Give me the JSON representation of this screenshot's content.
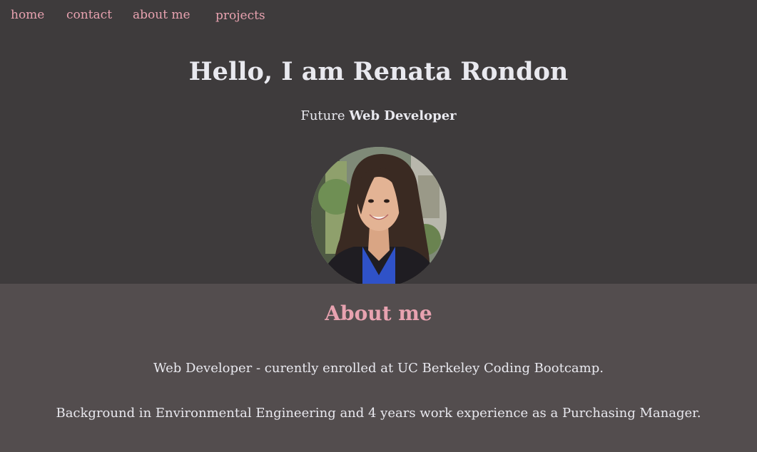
{
  "nav": {
    "items": [
      {
        "label": "home"
      },
      {
        "label": "contact"
      },
      {
        "label": "about me"
      },
      {
        "label": "projects"
      }
    ]
  },
  "hero": {
    "title": "Hello, I am Renata Rondon",
    "subtitle_prefix": "Future",
    "subtitle_emphasis": "Web Developer"
  },
  "about": {
    "heading": "About me",
    "paragraphs": [
      "Web Developer - curently enrolled at UC Berkeley Coding Bootcamp.",
      "Background in Environmental Engineering and 4 years work experience as a Purchasing Manager."
    ]
  },
  "colors": {
    "hero_bg": "#3e3b3c",
    "about_bg": "#534d4e",
    "accent_pink": "#e8a2b0",
    "text_light": "#e9e9ef"
  }
}
